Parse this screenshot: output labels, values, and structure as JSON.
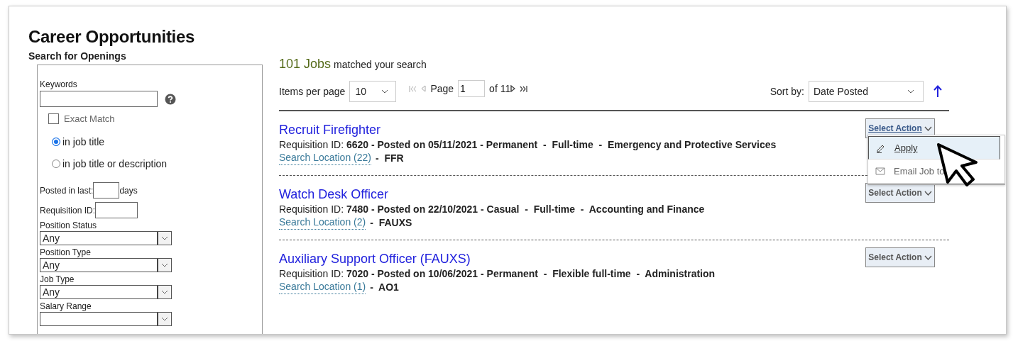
{
  "page": {
    "title": "Career Opportunities"
  },
  "search_panel": {
    "heading": "Search for Openings",
    "keywords": {
      "label": "Keywords"
    },
    "exact_match": {
      "label": "Exact Match",
      "checked": false
    },
    "scope_options": [
      {
        "label": "in job title",
        "selected": true
      },
      {
        "label": "in job title or description",
        "selected": false
      }
    ],
    "posted_in_last": {
      "label": "Posted in last:",
      "suffix": "days"
    },
    "requisition_id": {
      "label": "Requisition ID:"
    },
    "filters": [
      {
        "label": "Position Status",
        "value": "Any"
      },
      {
        "label": "Position Type",
        "value": "Any"
      },
      {
        "label": "Job Type",
        "value": "Any"
      },
      {
        "label": "Salary Range"
      }
    ]
  },
  "results": {
    "count": "101 Jobs",
    "count_suffix": "matched your search",
    "items_per_page_label": "Items per page",
    "items_per_page": "10",
    "page_label": "Page",
    "page": "1",
    "of_pages": "of 11",
    "sort_label": "Sort by:",
    "sort_value": "Date Posted",
    "jobs": [
      {
        "title": "Recruit Firefighter",
        "req_label": "Requisition ID:",
        "details": "6620 - Posted on 05/11/2021 - Permanent  -  Full-time  -  Emergency and Protective Services",
        "location_link": "Search Location (22)",
        "location_code": "-  FFR",
        "action": "Select Action",
        "menu_open": true
      },
      {
        "title": "Watch Desk Officer",
        "req_label": "Requisition ID:",
        "details": "7480 - Posted on 22/10/2021 - Casual  -  Full-time  -  Accounting and Finance",
        "location_link": "Search Location (2)",
        "location_code": "-  FAUXS",
        "action": "Select Action",
        "menu_open": false
      },
      {
        "title": "Auxiliary Support Officer (FAUXS)",
        "req_label": "Requisition ID:",
        "details": "7020 - Posted on 10/06/2021 - Permanent  -  Flexible full-time  -  Administration",
        "location_link": "Search Location (1)",
        "location_code": "-  AO1",
        "action": "Select Action",
        "menu_open": false
      }
    ],
    "action_menu": [
      {
        "kind": "apply",
        "label": "Apply",
        "selected": true
      },
      {
        "kind": "email",
        "label": "Email Job to",
        "selected": false
      }
    ]
  }
}
